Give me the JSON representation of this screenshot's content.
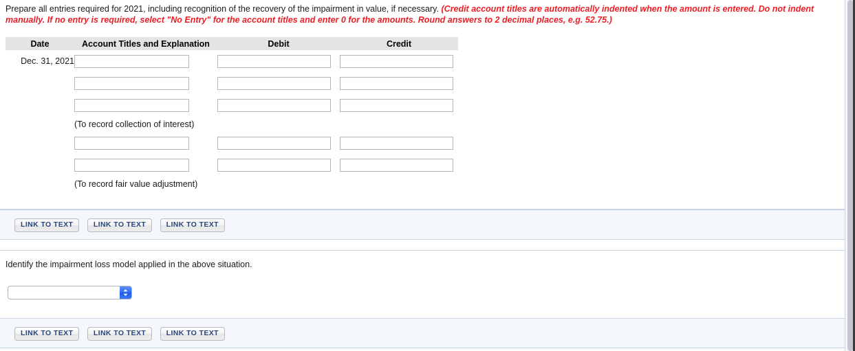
{
  "instruction": {
    "main": "Prepare all entries required for 2021, including recognition of the recovery of the impairment in value, if necessary. ",
    "note": "(Credit account titles are automatically indented when the amount is entered. Do not indent manually. If no entry is required, select \"No Entry\" for the account titles and enter 0 for the amounts. Round answers to 2 decimal places, e.g. 52.75.)"
  },
  "journal": {
    "headers": {
      "date": "Date",
      "account": "Account Titles and Explanation",
      "debit": "Debit",
      "credit": "Credit"
    },
    "date_value": "Dec. 31, 2021",
    "rows": [
      {
        "type": "entry",
        "date": "Dec. 31, 2021",
        "account": "",
        "debit": "",
        "credit": ""
      },
      {
        "type": "entry",
        "date": "",
        "account": "",
        "debit": "",
        "credit": ""
      },
      {
        "type": "entry",
        "date": "",
        "account": "",
        "debit": "",
        "credit": ""
      },
      {
        "type": "caption",
        "caption": "(To record collection of interest)"
      },
      {
        "type": "entry",
        "date": "",
        "account": "",
        "debit": "",
        "credit": ""
      },
      {
        "type": "entry",
        "date": "",
        "account": "",
        "debit": "",
        "credit": ""
      },
      {
        "type": "caption",
        "caption": "(To record fair value adjustment)"
      }
    ],
    "captions": {
      "interest": "(To record collection of interest)",
      "fair_value": "(To record fair value adjustment)"
    }
  },
  "buttons": {
    "link_to_text": "LINK TO TEXT",
    "bar1": [
      "LINK TO TEXT",
      "LINK TO TEXT",
      "LINK TO TEXT"
    ],
    "bar2": [
      "LINK TO TEXT",
      "LINK TO TEXT",
      "LINK TO TEXT"
    ]
  },
  "section2": {
    "prompt": "Identify the impairment loss model applied in the above situation.",
    "dropdown": {
      "selected": "",
      "options": [
        ""
      ]
    }
  },
  "colors": {
    "note_red": "#ee1c25",
    "button_text": "#28467d",
    "header_bg": "#e4e4e4",
    "panel_bg": "#f4f7fb",
    "panel_border": "#c9d4e3",
    "select_blue": "#2f6cf0"
  }
}
